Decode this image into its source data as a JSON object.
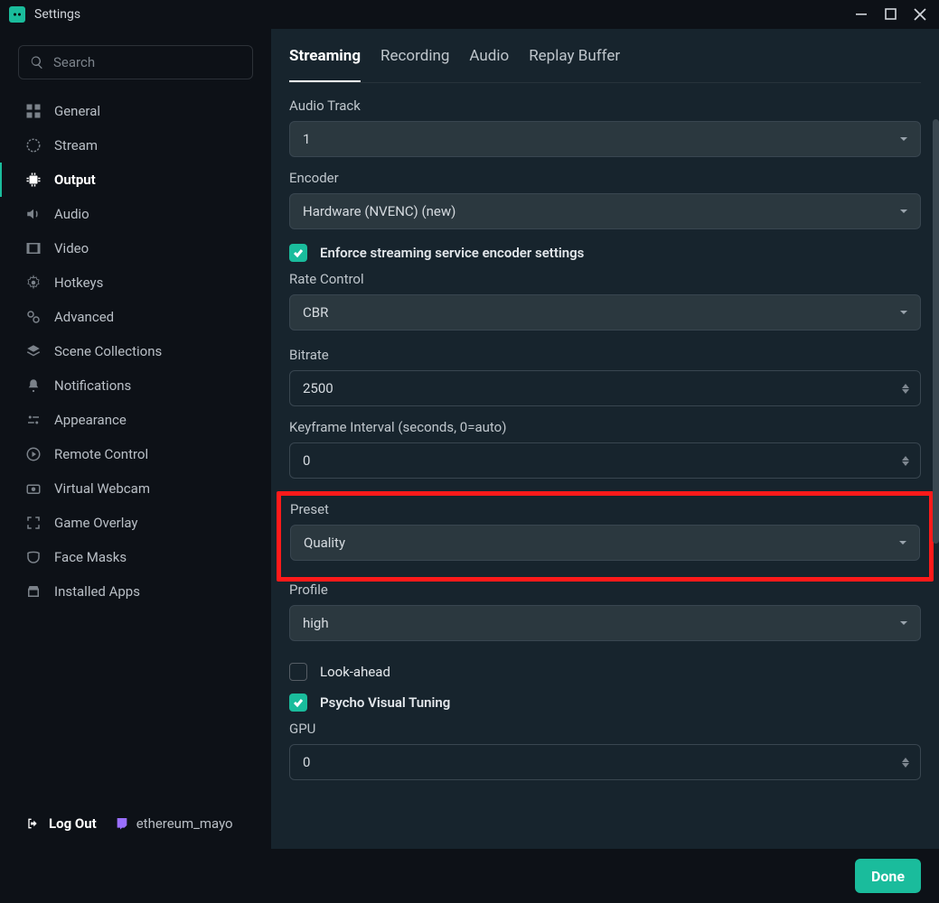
{
  "window": {
    "title": "Settings"
  },
  "search": {
    "placeholder": "Search"
  },
  "sidebar": {
    "items": [
      {
        "id": "general",
        "label": "General"
      },
      {
        "id": "stream",
        "label": "Stream"
      },
      {
        "id": "output",
        "label": "Output"
      },
      {
        "id": "audio",
        "label": "Audio"
      },
      {
        "id": "video",
        "label": "Video"
      },
      {
        "id": "hotkeys",
        "label": "Hotkeys"
      },
      {
        "id": "advanced",
        "label": "Advanced"
      },
      {
        "id": "scene-collections",
        "label": "Scene Collections"
      },
      {
        "id": "notifications",
        "label": "Notifications"
      },
      {
        "id": "appearance",
        "label": "Appearance"
      },
      {
        "id": "remote-control",
        "label": "Remote Control"
      },
      {
        "id": "virtual-webcam",
        "label": "Virtual Webcam"
      },
      {
        "id": "game-overlay",
        "label": "Game Overlay"
      },
      {
        "id": "face-masks",
        "label": "Face Masks"
      },
      {
        "id": "installed-apps",
        "label": "Installed Apps"
      }
    ],
    "active_id": "output"
  },
  "footer": {
    "logout_label": "Log Out",
    "username": "ethereum_mayo"
  },
  "tabs": {
    "items": [
      {
        "id": "streaming",
        "label": "Streaming"
      },
      {
        "id": "recording",
        "label": "Recording"
      },
      {
        "id": "audio",
        "label": "Audio"
      },
      {
        "id": "replay-buffer",
        "label": "Replay Buffer"
      }
    ],
    "active_id": "streaming"
  },
  "form": {
    "audio_track": {
      "label": "Audio Track",
      "value": "1"
    },
    "encoder": {
      "label": "Encoder",
      "value": "Hardware (NVENC) (new)"
    },
    "enforce": {
      "label": "Enforce streaming service encoder settings",
      "checked": true
    },
    "rate_control": {
      "label": "Rate Control",
      "value": "CBR"
    },
    "bitrate": {
      "label": "Bitrate",
      "value": "2500"
    },
    "keyframe_interval": {
      "label": "Keyframe Interval (seconds, 0=auto)",
      "value": "0"
    },
    "preset": {
      "label": "Preset",
      "value": "Quality"
    },
    "profile": {
      "label": "Profile",
      "value": "high"
    },
    "look_ahead": {
      "label": "Look-ahead",
      "checked": false
    },
    "psycho": {
      "label": "Psycho Visual Tuning",
      "checked": true
    },
    "gpu": {
      "label": "GPU",
      "value": "0"
    }
  },
  "actions": {
    "done_label": "Done"
  },
  "colors": {
    "accent": "#1abc9c",
    "highlight": "#ff1a1a"
  }
}
